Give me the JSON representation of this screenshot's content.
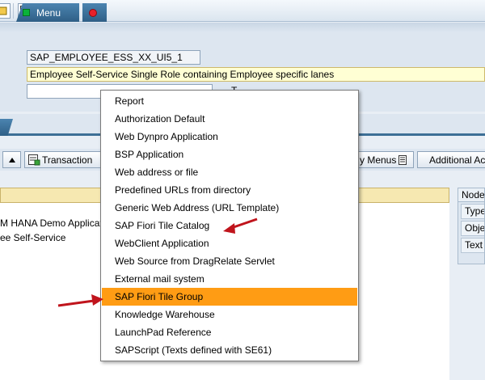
{
  "role": {
    "name": "SAP_EMPLOYEE_ESS_XX_UI5_1",
    "description": "Employee Self-Service Single Role containing Employee specific lanes",
    "side_label": "T"
  },
  "tabs": [
    {
      "label": "Menu"
    }
  ],
  "toolbar2": {
    "transaction_label": "Transaction",
    "copy_menus_label": "y Menus",
    "additional_label": "Additional Ac"
  },
  "tree": {
    "items": [
      {
        "label": "M HANA Demo Applicat"
      },
      {
        "label": "ee Self-Service"
      }
    ]
  },
  "node_panel": {
    "header": "Node",
    "rows": [
      "Type",
      "Obje",
      "Text"
    ]
  },
  "context_menu": {
    "items": [
      {
        "label": "Report"
      },
      {
        "label": "Authorization Default"
      },
      {
        "label": "Web Dynpro Application"
      },
      {
        "label": "BSP Application"
      },
      {
        "label": "Web address or file"
      },
      {
        "label": "Predefined URLs from directory"
      },
      {
        "label": "Generic Web Address (URL Template)"
      },
      {
        "label": "SAP Fiori Tile Catalog"
      },
      {
        "label": "WebClient Application"
      },
      {
        "label": "Web Source from DragRelate Servlet"
      },
      {
        "label": "External mail system"
      },
      {
        "label": "SAP Fiori Tile Group"
      },
      {
        "label": "Knowledge Warehouse"
      },
      {
        "label": "LaunchPad Reference"
      },
      {
        "label": "SAPScript (Texts defined with SE61)"
      }
    ],
    "highlighted": "SAP Fiori Tile Group",
    "highlight_color": "#ff9c14"
  },
  "annotations": {
    "arrow_color": "#c0141c"
  },
  "icons": [
    "save-icon",
    "layout-icon",
    "info-icon",
    "up-arrow-icon",
    "transaction-icon",
    "notepad-icon"
  ]
}
